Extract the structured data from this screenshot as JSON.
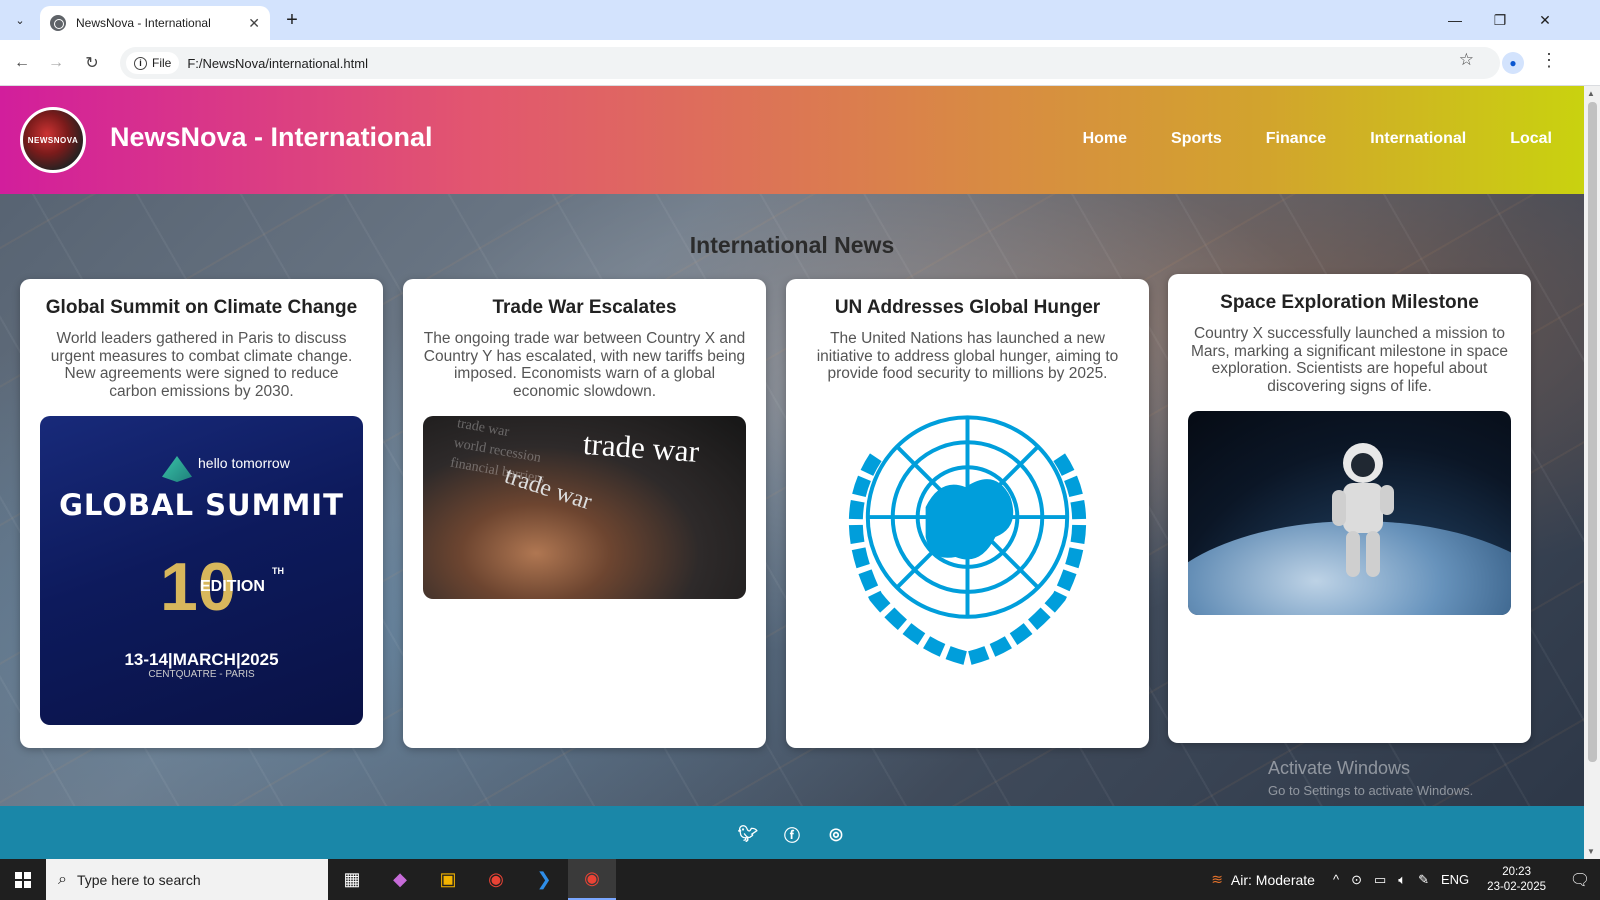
{
  "browser": {
    "tab_title": "NewsNova - International",
    "file_chip": "File",
    "url": "F:/NewsNova/international.html"
  },
  "site": {
    "logo_text": "NEWSNOVA",
    "title": "NewsNova - International",
    "nav": [
      "Home",
      "Sports",
      "Finance",
      "International",
      "Local"
    ]
  },
  "main": {
    "section_title": "International News",
    "articles": [
      {
        "title": "Global Summit on Climate Change",
        "body": "World leaders gathered in Paris to discuss urgent measures to combat climate change. New agreements were signed to reduce carbon emissions by 2030.",
        "image": {
          "brand": "hello tomorrow",
          "heading": "GLOBAL SUMMIT",
          "edition_num": "10",
          "edition_sup": "TH",
          "edition_word": "EDITION",
          "dates": "13-14|MARCH|2025",
          "venue": "CENTQUATRE - PARIS"
        }
      },
      {
        "title": "Trade War Escalates",
        "body": "The ongoing trade war between Country X and Country Y has escalated, with new tariffs being imposed. Economists warn of a global economic slowdown.",
        "image": {
          "headline": "trade war",
          "sub": "trade war",
          "bg_words": "trade war\nworld recession\nfinancial barriers"
        }
      },
      {
        "title": "UN Addresses Global Hunger",
        "body": "The United Nations has launched a new initiative to address global hunger, aiming to provide food security to millions by 2025.",
        "image": {
          "emblem_color": "#009edb"
        }
      },
      {
        "title": "Space Exploration Milestone",
        "body": "Country X successfully launched a mission to Mars, marking a significant milestone in space exploration. Scientists are hopeful about discovering signs of life.",
        "image": {}
      }
    ]
  },
  "watermark": {
    "line1": "Activate Windows",
    "line2": "Go to Settings to activate Windows."
  },
  "taskbar": {
    "search_placeholder": "Type here to search",
    "weather": "Air: Moderate",
    "language": "ENG",
    "time": "20:23",
    "date": "23-02-2025"
  },
  "colors": {
    "header_start": "#d21e9c",
    "header_end": "#c9d20f",
    "footer": "#1a87a8",
    "un_blue": "#009edb"
  }
}
